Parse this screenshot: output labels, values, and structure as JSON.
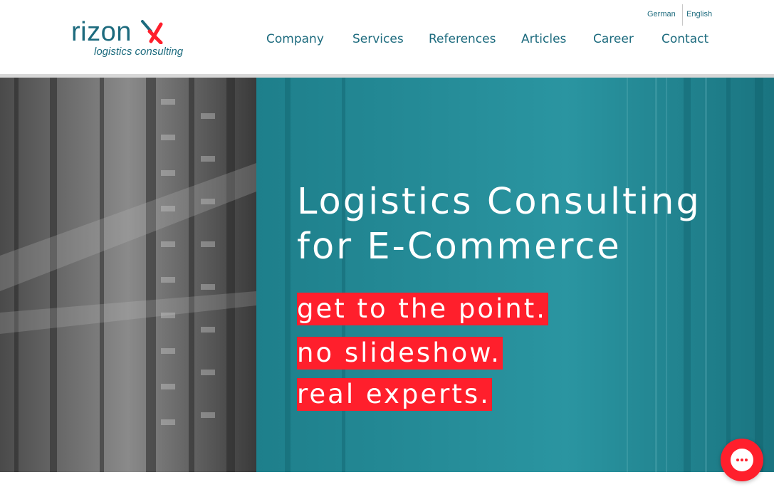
{
  "brand": {
    "name": "rizon",
    "subtitle": "logistics consulting",
    "colors": {
      "teal": "#1d6b7e",
      "accent_red": "#ff1f2c",
      "hero_teal": "#1b7f8c"
    }
  },
  "languages": {
    "german": "German",
    "english": "English"
  },
  "nav": [
    {
      "label": "Company"
    },
    {
      "label": "Services"
    },
    {
      "label": "References"
    },
    {
      "label": "Articles"
    },
    {
      "label": "Career"
    },
    {
      "label": "Contact"
    }
  ],
  "hero": {
    "headline_line1": "Logistics Consulting",
    "headline_line2": "for E-Commerce",
    "taglines": [
      "get to the point.",
      "no slideshow.",
      "real experts."
    ]
  },
  "chat": {
    "icon": "chat-bubble-icon"
  }
}
